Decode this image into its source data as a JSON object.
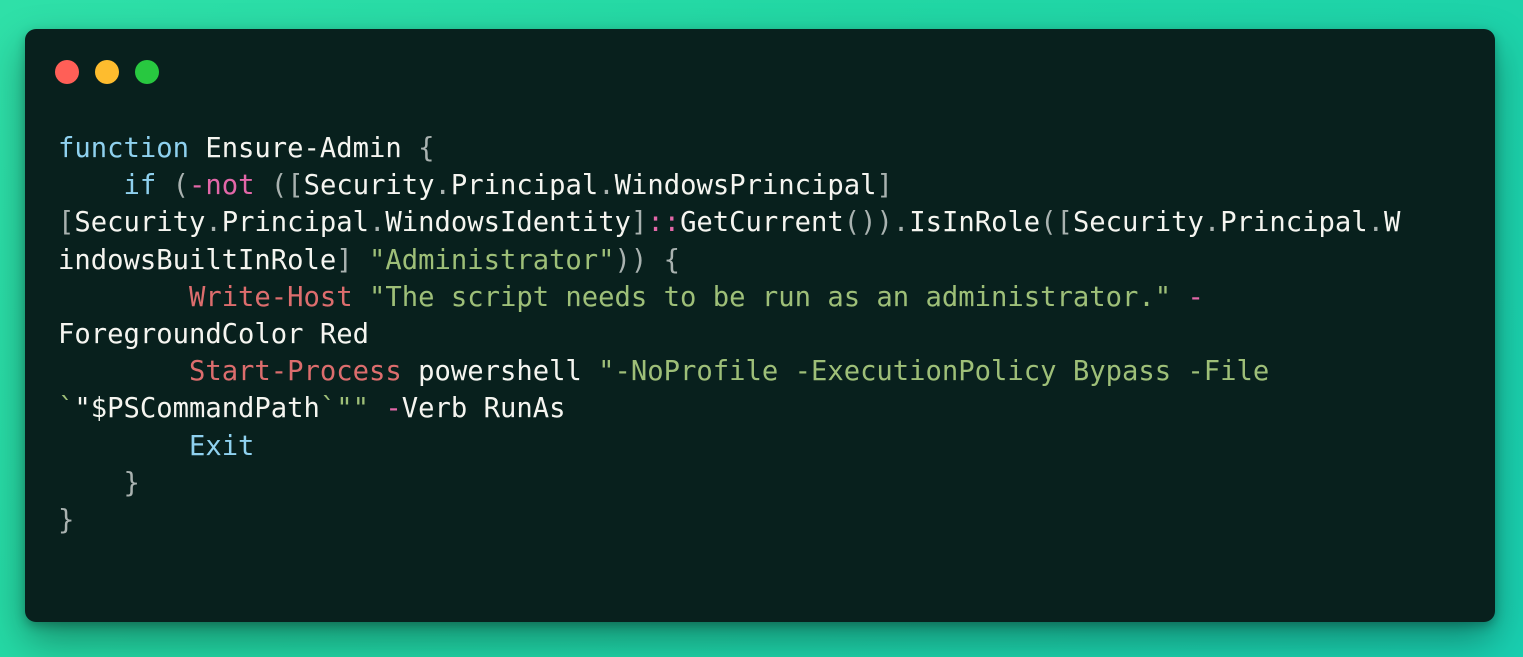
{
  "window": {
    "traffic_lights": [
      {
        "name": "close",
        "color": "#ff5f57"
      },
      {
        "name": "minimize",
        "color": "#febc2e"
      },
      {
        "name": "maximize",
        "color": "#28c840"
      }
    ]
  },
  "code": {
    "language": "powershell",
    "lines": [
      [
        {
          "t": "function",
          "c": "kw"
        },
        {
          "t": " Ensure-Admin ",
          "c": "id"
        },
        {
          "t": "{",
          "c": "pun"
        }
      ],
      [
        {
          "t": "    ",
          "c": "id"
        },
        {
          "t": "if",
          "c": "kw"
        },
        {
          "t": " ",
          "c": "id"
        },
        {
          "t": "(",
          "c": "pun"
        },
        {
          "t": "-not",
          "c": "op"
        },
        {
          "t": " ",
          "c": "id"
        },
        {
          "t": "([",
          "c": "pun"
        },
        {
          "t": "Security",
          "c": "id"
        },
        {
          "t": ".",
          "c": "pun"
        },
        {
          "t": "Principal",
          "c": "id"
        },
        {
          "t": ".",
          "c": "pun"
        },
        {
          "t": "WindowsPrincipal",
          "c": "id"
        },
        {
          "t": "]",
          "c": "pun"
        }
      ],
      [
        {
          "t": "[",
          "c": "pun"
        },
        {
          "t": "Security",
          "c": "id"
        },
        {
          "t": ".",
          "c": "pun"
        },
        {
          "t": "Principal",
          "c": "id"
        },
        {
          "t": ".",
          "c": "pun"
        },
        {
          "t": "WindowsIdentity",
          "c": "id"
        },
        {
          "t": "]",
          "c": "pun"
        },
        {
          "t": "::",
          "c": "op"
        },
        {
          "t": "GetCurrent",
          "c": "id"
        },
        {
          "t": "()).",
          "c": "pun"
        },
        {
          "t": "IsInRole",
          "c": "id"
        },
        {
          "t": "([",
          "c": "pun"
        },
        {
          "t": "Security",
          "c": "id"
        },
        {
          "t": ".",
          "c": "pun"
        },
        {
          "t": "Principal",
          "c": "id"
        },
        {
          "t": ".",
          "c": "pun"
        },
        {
          "t": "W",
          "c": "id"
        }
      ],
      [
        {
          "t": "indowsBuiltInRole",
          "c": "id"
        },
        {
          "t": "]",
          "c": "pun"
        },
        {
          "t": " ",
          "c": "id"
        },
        {
          "t": "\"Administrator\"",
          "c": "str"
        },
        {
          "t": ")) ",
          "c": "pun"
        },
        {
          "t": "{",
          "c": "pun"
        }
      ],
      [
        {
          "t": "        ",
          "c": "id"
        },
        {
          "t": "Write-Host",
          "c": "cmd"
        },
        {
          "t": " ",
          "c": "id"
        },
        {
          "t": "\"The script needs to be run as an administrator.\"",
          "c": "str"
        },
        {
          "t": " ",
          "c": "id"
        },
        {
          "t": "-",
          "c": "op"
        }
      ],
      [
        {
          "t": "ForegroundColor Red",
          "c": "id"
        }
      ],
      [
        {
          "t": "        ",
          "c": "id"
        },
        {
          "t": "Start-Process",
          "c": "cmd"
        },
        {
          "t": " powershell ",
          "c": "id"
        },
        {
          "t": "\"-NoProfile -ExecutionPolicy Bypass -File",
          "c": "str"
        }
      ],
      [
        {
          "t": "`",
          "c": "str"
        },
        {
          "t": "\"$PSCommandPath",
          "c": "id"
        },
        {
          "t": "`",
          "c": "str"
        },
        {
          "t": "\"\"",
          "c": "str"
        },
        {
          "t": " ",
          "c": "id"
        },
        {
          "t": "-",
          "c": "op"
        },
        {
          "t": "Verb RunAs",
          "c": "id"
        }
      ],
      [
        {
          "t": "        ",
          "c": "id"
        },
        {
          "t": "Exit",
          "c": "kw"
        }
      ],
      [
        {
          "t": "    ",
          "c": "id"
        },
        {
          "t": "}",
          "c": "pun"
        }
      ],
      [
        {
          "t": "}",
          "c": "pun"
        }
      ]
    ]
  }
}
